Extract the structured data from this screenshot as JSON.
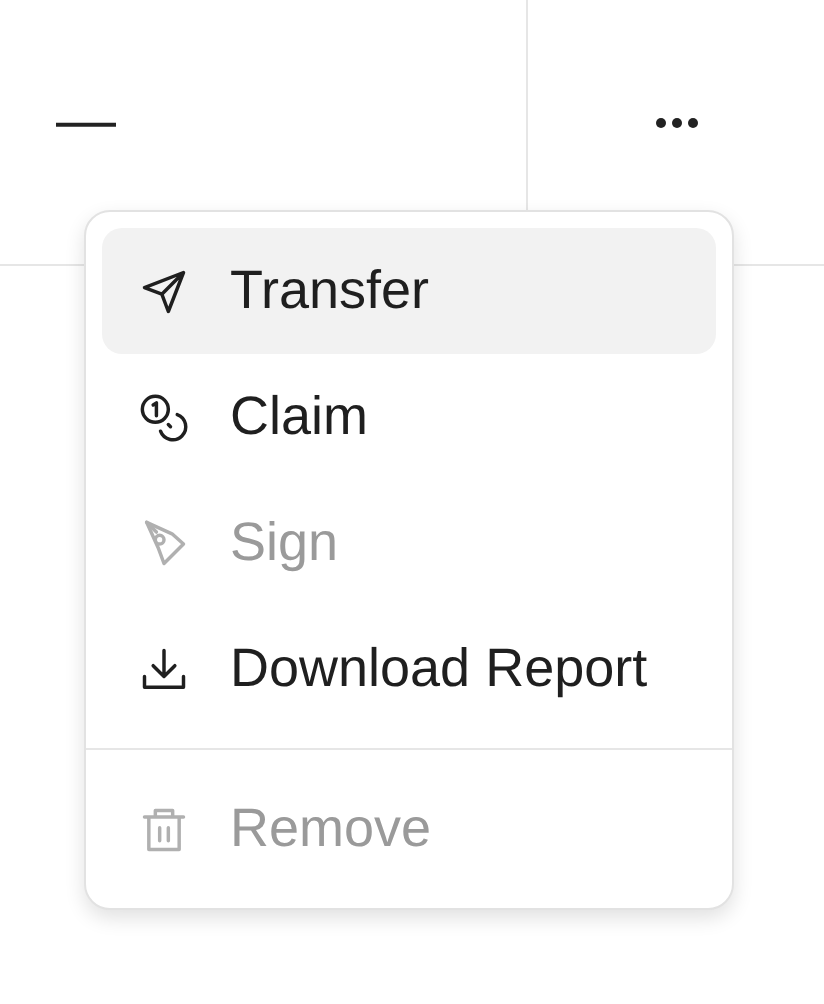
{
  "table": {
    "cells": [
      {
        "text": "—"
      },
      {
        "kind": "more-button"
      }
    ]
  },
  "menu": {
    "items": [
      {
        "kind": "item",
        "label": "Transfer",
        "selected": true,
        "disabled": false
      },
      {
        "kind": "item",
        "label": "Claim",
        "selected": false,
        "disabled": false
      },
      {
        "kind": "item",
        "label": "Sign",
        "selected": false,
        "disabled": true
      },
      {
        "kind": "item",
        "label": "Download Report",
        "selected": false,
        "disabled": false
      },
      {
        "kind": "separator"
      },
      {
        "kind": "item",
        "label": "Remove",
        "selected": false,
        "disabled": true
      }
    ]
  }
}
